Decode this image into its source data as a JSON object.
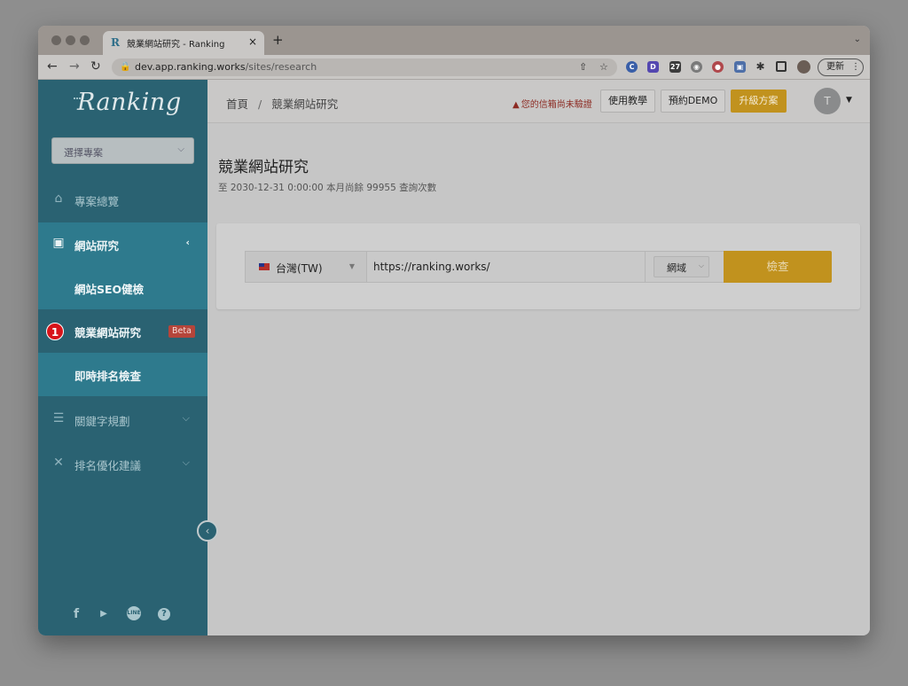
{
  "browser": {
    "tab_title": "競業網站研究 - Ranking",
    "tab_favicon": "R",
    "tab_close": "×",
    "new_tab": "+",
    "tab_menu": "⌄",
    "url_host": "dev.app.ranking.works",
    "url_path": "/sites/research",
    "update_label": "更新",
    "update_menu": "⋮",
    "icons": [
      "back-icon",
      "forward-icon",
      "reload-icon",
      "lock-icon",
      "share-icon",
      "bookmark-star-icon",
      "extension-icons",
      "puzzle-icon",
      "sidepanel-icon",
      "profile-icon"
    ],
    "ext_labels": [
      "C",
      "D",
      "27",
      "◉",
      "●",
      "▣"
    ]
  },
  "sidebar": {
    "logo": "Ranking",
    "project_select": {
      "placeholder": "選擇專案",
      "chevron": "⌵"
    },
    "items": [
      {
        "label": "專案總覽",
        "icon": "home-icon"
      },
      {
        "label": "網站研究",
        "icon": "monitor-icon",
        "expanded": true,
        "arrow": "‹"
      },
      {
        "label": "關鍵字規劃",
        "icon": "keyword-icon",
        "arrow": "⌵"
      },
      {
        "label": "排名優化建議",
        "icon": "tools-icon",
        "arrow": "⌵"
      }
    ],
    "sub_items": [
      {
        "label": "網站SEO健檢"
      },
      {
        "label": "競業網站研究",
        "badge": "Beta",
        "step": "1",
        "selected": true
      },
      {
        "label": "即時排名檢查"
      }
    ],
    "collapse": "‹",
    "social": [
      "facebook-icon",
      "youtube-icon",
      "line-icon",
      "help-icon"
    ],
    "social_glyphs": {
      "facebook": "f",
      "youtube": "▶",
      "line": "LINE",
      "help": "?"
    }
  },
  "topbar": {
    "breadcrumb": [
      "首頁",
      "競業網站研究"
    ],
    "breadcrumb_sep": "/",
    "warning_icon": "▲",
    "warning": "您的信箱尚未驗證",
    "tutorial_btn": "使用教學",
    "demo_btn": "預約DEMO",
    "upgrade_btn": "升級方案",
    "avatar": "T",
    "avatar_caret": "▼"
  },
  "main": {
    "title": "競業網站研究",
    "subtitle": "至 2030-12-31 0:00:00 本月尚餘 99955 查詢次數",
    "search": {
      "country": "台灣(TW)",
      "country_caret": "▼",
      "url_value": "https://ranking.works/",
      "scope": "網域",
      "scope_caret": "⌵",
      "submit": "檢查"
    }
  },
  "colors": {
    "sidebar": "#2a6272",
    "sidebar_active": "#2e7a8d",
    "accent": "#c1921e",
    "beta": "#b5453a",
    "step_badge": "#d7141a"
  }
}
